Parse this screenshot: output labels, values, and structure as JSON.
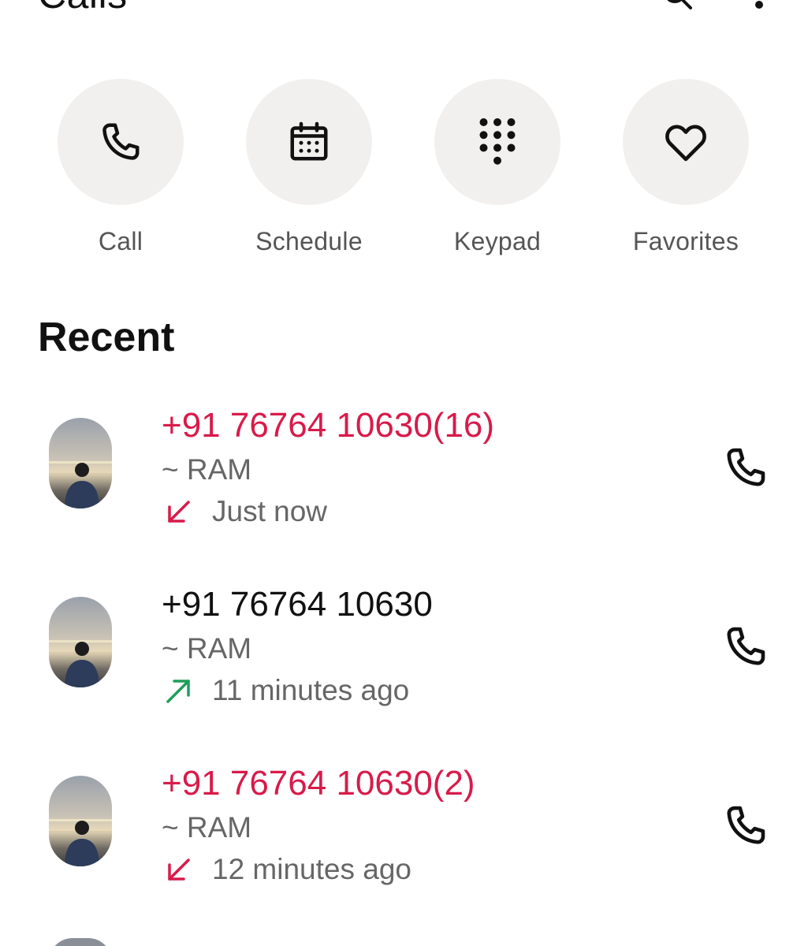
{
  "header": {
    "title": "Calls",
    "search_icon": "search-icon",
    "more_icon": "more-vert-icon"
  },
  "actions": [
    {
      "label": "Call",
      "icon": "phone-icon"
    },
    {
      "label": "Schedule",
      "icon": "calendar-icon"
    },
    {
      "label": "Keypad",
      "icon": "dialpad-icon"
    },
    {
      "label": "Favorites",
      "icon": "heart-icon"
    }
  ],
  "recent": {
    "title": "Recent",
    "items": [
      {
        "number": "+91 76764 10630",
        "count": "(16)",
        "name": "~ RAM",
        "direction": "incoming-missed",
        "time": "Just now",
        "missed": true
      },
      {
        "number": "+91 76764 10630",
        "count": "",
        "name": "~ RAM",
        "direction": "outgoing",
        "time": "11 minutes ago",
        "missed": false
      },
      {
        "number": "+91 76764 10630",
        "count": "(2)",
        "name": "~ RAM",
        "direction": "incoming-missed",
        "time": "12 minutes ago",
        "missed": true
      }
    ]
  },
  "colors": {
    "missed": "#d81b4a",
    "outgoing": "#1e9e5a",
    "action_bg": "#f2f0ee",
    "text_primary": "#111111",
    "text_secondary": "#666666"
  }
}
